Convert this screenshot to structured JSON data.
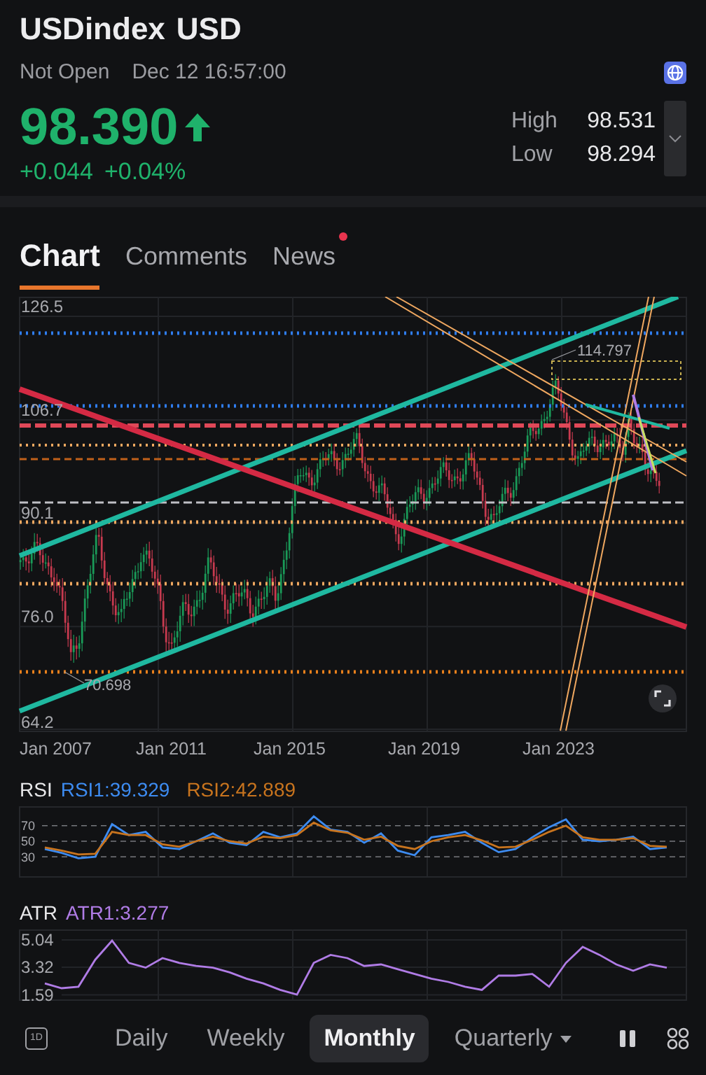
{
  "header": {
    "symbol": "USDindex",
    "currency": "USD",
    "status": "Not Open",
    "time": "Dec 12 16:57:00",
    "price": "98.390",
    "rising": true,
    "change": "+0.044",
    "change_pct": "+0.04%",
    "stats": [
      {
        "label": "High",
        "value": "98.531"
      },
      {
        "label": "Low",
        "value": "98.294"
      }
    ]
  },
  "tabs": [
    {
      "label": "Chart",
      "selected": true,
      "badge": false
    },
    {
      "label": "Comments",
      "selected": false,
      "badge": false
    },
    {
      "label": "News",
      "selected": false,
      "badge": true
    }
  ],
  "main_chart": {
    "yticks": [
      "126.5",
      "106.7",
      "90.1",
      "76.0",
      "64.2"
    ],
    "xticks": [
      "Jan 2007",
      "Jan 2011",
      "Jan 2015",
      "Jan 2019",
      "Jan 2023"
    ],
    "price_labels": [
      {
        "text": "114.797",
        "kind": "high"
      },
      {
        "text": "70.698",
        "kind": "low"
      }
    ]
  },
  "rsi": {
    "title": "RSI",
    "readings": [
      "RSI1:39.329",
      "RSI2:42.889"
    ],
    "chart_data": {
      "type": "line",
      "grid": true,
      "ylim": [
        5,
        95
      ],
      "yticks": [
        {
          "value": 70,
          "label": "70"
        },
        {
          "value": 50,
          "label": "50"
        },
        {
          "value": 30,
          "label": "30"
        }
      ],
      "series": [
        {
          "color": "#3d8bf0",
          "values": [
            40,
            35,
            28,
            30,
            72,
            58,
            62,
            42,
            40,
            50,
            60,
            48,
            45,
            62,
            55,
            60,
            82,
            65,
            62,
            48,
            60,
            38,
            32,
            55,
            58,
            62,
            48,
            36,
            40,
            55,
            68,
            78,
            52,
            50,
            52,
            56,
            40,
            42
          ]
        },
        {
          "color": "#c8741e",
          "values": [
            42,
            38,
            33,
            34,
            62,
            58,
            58,
            46,
            43,
            50,
            56,
            50,
            47,
            56,
            54,
            58,
            74,
            64,
            61,
            52,
            56,
            44,
            40,
            50,
            55,
            58,
            51,
            42,
            43,
            52,
            62,
            70,
            55,
            52,
            52,
            54,
            44,
            43
          ]
        }
      ]
    }
  },
  "atr": {
    "title": "ATR",
    "readings": [
      "ATR1:3.277"
    ],
    "chart_data": {
      "type": "line",
      "grid": true,
      "ylim": [
        1.3,
        5.7
      ],
      "yticks": [
        {
          "value": 5.04,
          "label": "5.04"
        },
        {
          "value": 3.32,
          "label": "3.32"
        },
        {
          "value": 1.59,
          "label": "1.59"
        }
      ],
      "series": [
        {
          "color": "#b07ce6",
          "values": [
            2.3,
            2.0,
            2.1,
            3.8,
            5.0,
            3.6,
            3.3,
            3.9,
            3.6,
            3.4,
            3.3,
            3.0,
            2.6,
            2.3,
            1.9,
            1.6,
            3.6,
            4.1,
            3.9,
            3.4,
            3.5,
            3.2,
            2.9,
            2.6,
            2.4,
            2.1,
            1.9,
            2.8,
            2.8,
            2.9,
            2.1,
            3.6,
            4.6,
            4.1,
            3.5,
            3.1,
            3.5,
            3.3
          ]
        }
      ]
    }
  },
  "toolbar": {
    "day_icon": "1D",
    "periods": [
      {
        "label": "Daily",
        "selected": false,
        "dropdown": false
      },
      {
        "label": "Weekly",
        "selected": false,
        "dropdown": false
      },
      {
        "label": "Monthly",
        "selected": true,
        "dropdown": false
      },
      {
        "label": "Quarterly",
        "selected": false,
        "dropdown": true
      }
    ]
  }
}
